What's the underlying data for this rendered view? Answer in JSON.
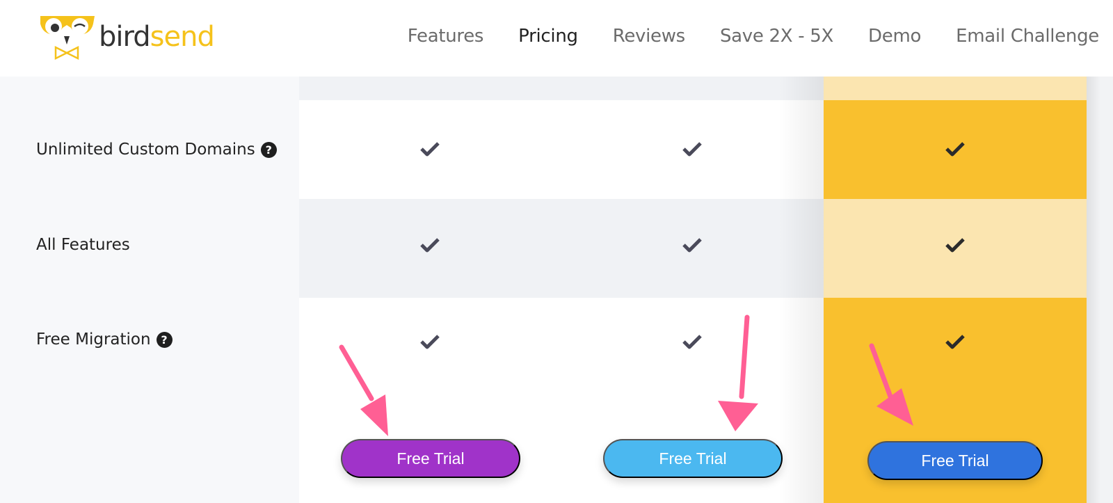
{
  "logo": {
    "word_bird": "bird",
    "word_send": "send",
    "icon": "owl-logo-icon"
  },
  "nav": {
    "items": [
      {
        "label": "Features",
        "active": false
      },
      {
        "label": "Pricing",
        "active": true
      },
      {
        "label": "Reviews",
        "active": false
      },
      {
        "label": "Save 2X - 5X",
        "active": false
      },
      {
        "label": "Demo",
        "active": false
      },
      {
        "label": "Email Challenge",
        "active": false
      }
    ]
  },
  "rows": [
    {
      "label": "Unlimited Custom Domains",
      "help_icon": true,
      "plans": [
        true,
        true,
        true
      ]
    },
    {
      "label": "All Features",
      "help_icon": false,
      "plans": [
        true,
        true,
        true
      ]
    },
    {
      "label": "Free Migration",
      "help_icon": true,
      "plans": [
        true,
        true,
        true
      ]
    }
  ],
  "buttons": [
    {
      "label": "Free Trial",
      "color": "#a033c9"
    },
    {
      "label": "Free Trial",
      "color": "#4bb8f0"
    },
    {
      "label": "Free Trial",
      "color": "#2f73de"
    }
  ],
  "help_glyph": "?",
  "colors": {
    "brand_yellow": "#f5c21b",
    "highlight_column": "#f9c02e",
    "highlight_column_light": "#fbe5b0",
    "arrow_pink": "#ff5f94",
    "check": "#4a4a5a"
  }
}
